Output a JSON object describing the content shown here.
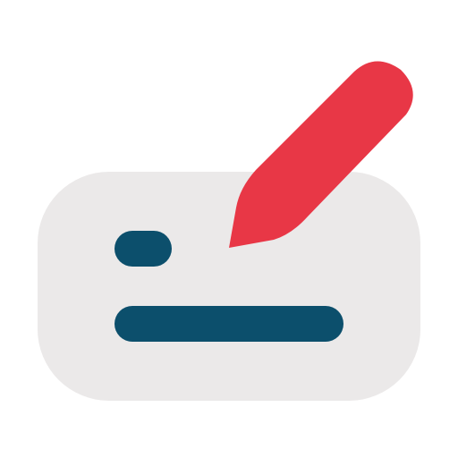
{
  "icon": {
    "name": "signature-edit-icon",
    "parts": {
      "card": "card-shape",
      "pencil": "pencil-icon"
    }
  },
  "colors": {
    "background": "#ffffff",
    "card": "#ebe9e9",
    "lines": "#0c4f6c",
    "pencil": "#e83746"
  }
}
